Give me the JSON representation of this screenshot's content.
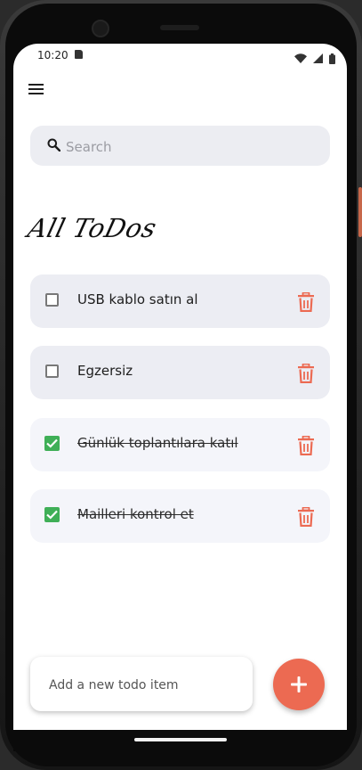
{
  "status_bar": {
    "time": "10:20",
    "icons": [
      "sd-card-icon",
      "wifi-icon",
      "signal-icon",
      "battery-icon"
    ]
  },
  "search": {
    "placeholder": "Search"
  },
  "title": "All ToDos",
  "todos": [
    {
      "text": "USB kablo satın al",
      "done": false
    },
    {
      "text": "Egzersiz",
      "done": false
    },
    {
      "text": "Günlük toplantılara katıl",
      "done": true
    },
    {
      "text": "Mailleri kontrol et",
      "done": true
    }
  ],
  "add_todo": {
    "placeholder": "Add a new todo item",
    "button_icon": "plus-icon"
  },
  "colors": {
    "accent": "#ec6a52",
    "check": "#3faf57",
    "item_bg": "#ecedf3",
    "delete": "#ec6a52"
  }
}
